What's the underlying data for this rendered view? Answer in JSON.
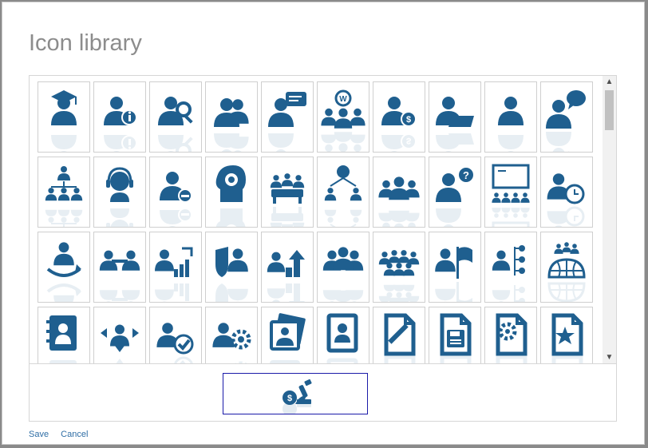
{
  "dialog": {
    "title": "Icon library"
  },
  "icon_color": "#1f5f8f",
  "icons": [
    {
      "name": "graduate-icon"
    },
    {
      "name": "person-info-icon"
    },
    {
      "name": "person-search-icon"
    },
    {
      "name": "two-people-icon"
    },
    {
      "name": "person-speech-icon"
    },
    {
      "name": "idea-group-icon"
    },
    {
      "name": "person-money-icon"
    },
    {
      "name": "person-laptop-icon"
    },
    {
      "name": "person-icon"
    },
    {
      "name": "person-comment-icon"
    },
    {
      "name": "org-chart-icon"
    },
    {
      "name": "headset-support-icon"
    },
    {
      "name": "person-remove-icon"
    },
    {
      "name": "head-gear-icon"
    },
    {
      "name": "meeting-table-icon"
    },
    {
      "name": "network-people-icon"
    },
    {
      "name": "team-group-icon"
    },
    {
      "name": "person-question-icon"
    },
    {
      "name": "presentation-board-icon"
    },
    {
      "name": "person-clock-icon"
    },
    {
      "name": "person-cycle-icon"
    },
    {
      "name": "people-handshake-icon"
    },
    {
      "name": "person-growth-chart-icon"
    },
    {
      "name": "person-shield-icon"
    },
    {
      "name": "career-growth-icon"
    },
    {
      "name": "business-team-icon"
    },
    {
      "name": "crowd-icon"
    },
    {
      "name": "person-flag-icon"
    },
    {
      "name": "person-hierarchy-icon"
    },
    {
      "name": "global-team-icon"
    },
    {
      "name": "contact-book-icon"
    },
    {
      "name": "person-directions-icon"
    },
    {
      "name": "person-check-icon"
    },
    {
      "name": "person-settings-icon"
    },
    {
      "name": "photo-gallery-icon"
    },
    {
      "name": "address-book-icon"
    },
    {
      "name": "document-edit-icon"
    },
    {
      "name": "document-save-icon"
    },
    {
      "name": "document-settings-icon"
    },
    {
      "name": "document-star-icon"
    }
  ],
  "preview": {
    "icon": "money-microscope-icon"
  },
  "footer": {
    "save_label": "Save",
    "cancel_label": "Cancel"
  }
}
